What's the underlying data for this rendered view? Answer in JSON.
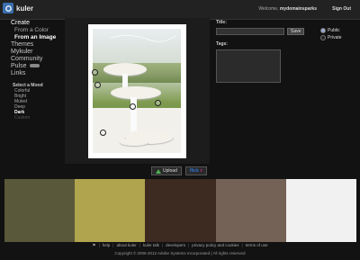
{
  "header": {
    "app_name": "kuler",
    "welcome_text": "Welcome",
    "username": "mydomainsparks",
    "signout_label": "Sign Out"
  },
  "nav": {
    "create": "Create",
    "from_color": "From a Color",
    "from_image": "From an Image",
    "themes": "Themes",
    "mykuler": "Mykuler",
    "community": "Community",
    "pulse": "Pulse",
    "links": "Links"
  },
  "mood": {
    "title": "Select a Mood",
    "options": [
      "Colorful",
      "Bright",
      "Muted",
      "Deep",
      "Dark",
      "Custom"
    ],
    "selected": "Dark"
  },
  "buttons": {
    "upload": "Upload",
    "flickr_a": "flick",
    "flickr_b": "r"
  },
  "form": {
    "title_label": "Title:",
    "title_value": "",
    "save_label": "Save",
    "tags_label": "Tags:",
    "public_label": "Public",
    "private_label": "Private",
    "visibility_selected": "Public"
  },
  "swatches": [
    {
      "color": "#59583a"
    },
    {
      "color": "#b0a44e"
    },
    {
      "color": "#3d2a21"
    },
    {
      "color": "#746257"
    },
    {
      "color": "#f1f1f1"
    }
  ],
  "footer": {
    "links": [
      "help",
      "about kuler",
      "kuler talk",
      "developers",
      "privacy policy and cookies",
      "terms of use"
    ],
    "copyright": "Copyright © 2006-2012 Adobe Systems Incorporated | All rights reserved"
  }
}
